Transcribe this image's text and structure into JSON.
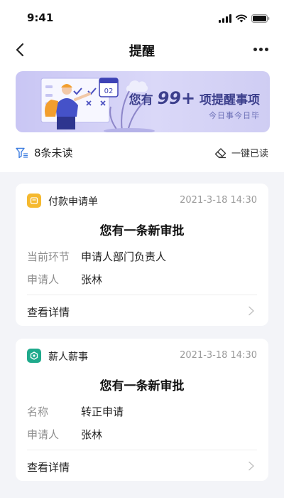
{
  "status_bar": {
    "time": "9:41"
  },
  "nav": {
    "title": "提醒"
  },
  "banner": {
    "prefix": "您有",
    "count": "99+",
    "suffix": "项提醒事项",
    "subtitle": "今日事今日毕",
    "calendar_day": "02"
  },
  "filter": {
    "unread_label": "8条未读",
    "read_all_label": "一键已读"
  },
  "cards": [
    {
      "source": "付款申请单",
      "icon": "payment-app-icon",
      "icon_color": "#f5b92f",
      "time": "2021-3-18 14:30",
      "title": "您有一条新审批",
      "fields": [
        {
          "label": "当前环节",
          "value": "申请人部门负责人"
        },
        {
          "label": "申请人",
          "value": "张林"
        }
      ],
      "detail_label": "查看详情"
    },
    {
      "source": "薪人薪事",
      "icon": "hr-app-icon",
      "icon_color": "#1faa8c",
      "time": "2021-3-18 14:30",
      "title": "您有一条新审批",
      "fields": [
        {
          "label": "名称",
          "value": "转正申请"
        },
        {
          "label": "申请人",
          "value": "张林"
        }
      ],
      "detail_label": "查看详情"
    }
  ]
}
